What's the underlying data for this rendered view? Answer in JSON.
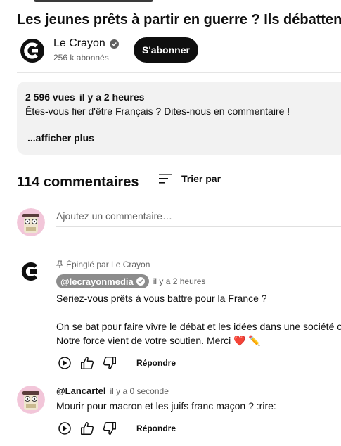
{
  "video": {
    "title": "Les jeunes prêts à partir en guerre ? Ils débattent."
  },
  "channel": {
    "name": "Le Crayon",
    "subscribers": "256 k abonnés",
    "subscribe_label": "S'abonner"
  },
  "description": {
    "views": "2 596 vues",
    "time": "il y a 2 heures",
    "text": "Êtes-vous fier d'être Français ? Dites-nous en commentaire !",
    "more_label": "...afficher plus"
  },
  "comments_header": {
    "count": "114 commentaires",
    "sort_label": "Trier par"
  },
  "add_comment": {
    "placeholder": "Ajoutez un commentaire…"
  },
  "comments": [
    {
      "pinned": "Épinglé par Le Crayon",
      "author": "@lecrayonmedia",
      "time": "il y a 2 heures",
      "lines": [
        "Seriez-vous prêts à vous battre pour la France ?",
        "",
        "On se bat pour faire vivre le débat et les idées dans une société cl",
        "Notre force vient de votre soutien. Merci  ❤️ ✏️"
      ],
      "reply_label": "Répondre"
    },
    {
      "author": "@Lancartel",
      "time": "il y a 0 seconde",
      "lines": [
        "Mourir pour macron et les juifs franc maçon ? :rire:"
      ],
      "reply_label": "Répondre"
    }
  ],
  "colors": {
    "accent": "#0f0f0f",
    "muted": "#606060",
    "panel": "#f2f2f2",
    "chip": "#8c8c8c"
  },
  "icons": [
    "crayon-logo-icon",
    "verified-icon",
    "sort-icon",
    "pin-icon",
    "play-icon",
    "thumbs-up-icon",
    "thumbs-down-icon"
  ]
}
